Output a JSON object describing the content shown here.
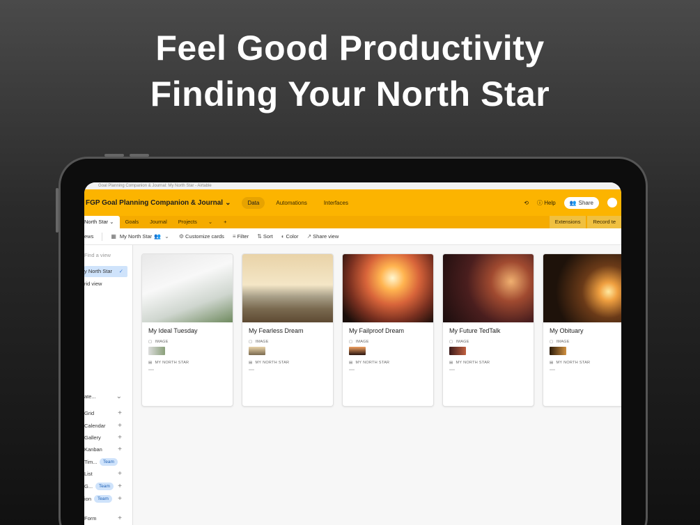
{
  "headline": {
    "line1": "Feel Good Productivity",
    "line2": "Finding Your North Star"
  },
  "os_bar": "Goal Planning Companion & Journal: My North Star - Airtable",
  "app": {
    "base_title": "FGP Goal Planning Companion & Journal",
    "nav": [
      "Data",
      "Automations",
      "Interfaces"
    ],
    "help": "Help",
    "share": "Share"
  },
  "tabs": {
    "active": "North Star",
    "items": [
      "Goals",
      "Journal",
      "Projects"
    ],
    "right": [
      "Extensions",
      "Record te"
    ]
  },
  "toolbar": {
    "views": "ews",
    "view_name": "My North Star",
    "customize": "Customize cards",
    "filter": "Filter",
    "sort": "Sort",
    "color": "Color",
    "share_view": "Share view"
  },
  "sidebar": {
    "find": "Find a view",
    "views": [
      "y North Star",
      "rid view"
    ],
    "create_header": "ate...",
    "create": [
      {
        "label": "Grid",
        "badge": ""
      },
      {
        "label": "Calendar",
        "badge": ""
      },
      {
        "label": "Gallery",
        "badge": ""
      },
      {
        "label": "Kanban",
        "badge": ""
      },
      {
        "label": "Tim...",
        "badge": "Team"
      },
      {
        "label": "List",
        "badge": ""
      },
      {
        "label": "G...",
        "badge": "Team"
      },
      {
        "label": "ion",
        "badge": "Team"
      },
      {
        "label": "Form",
        "badge": ""
      }
    ]
  },
  "field_labels": {
    "image": "IMAGE",
    "north_star": "MY NORTH STAR"
  },
  "cards": [
    {
      "title": "My Ideal Tuesday",
      "image": "coffee-table-icon"
    },
    {
      "title": "My Fearless Dream",
      "image": "cliff-jump-icon"
    },
    {
      "title": "My Failproof Dream",
      "image": "sunset-summit-icon"
    },
    {
      "title": "My Future TedTalk",
      "image": "speaker-audience-icon"
    },
    {
      "title": "My Obituary",
      "image": "candle-icon"
    }
  ]
}
